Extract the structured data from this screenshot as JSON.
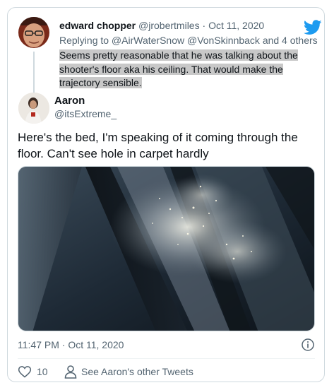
{
  "colors": {
    "brand": "#1d9bf0",
    "muted": "#536471",
    "border": "#cfd9de",
    "highlight": "#c8c8c8"
  },
  "reply_tweet": {
    "display_name": "edward chopper",
    "handle": "@jrobertmiles",
    "separator": "·",
    "date": "Oct 11, 2020",
    "replying_to": "Replying to @AirWaterSnow @VonSkinnback and 4 others",
    "text": "Seems pretty reasonable that he was talking about the shooter's floor aka his ceiling. That would make the trajectory sensible."
  },
  "main_tweet": {
    "display_name": "Aaron",
    "handle": "@itsExtreme_",
    "text": "Here's the bed, I'm speaking of it coming through the floor. Can't see hole in carpet hardly",
    "timestamp": "11:47 PM · Oct 11, 2020",
    "likes": "10",
    "see_more": "See Aaron's other Tweets"
  },
  "icons": [
    "twitter-bird-icon",
    "info-icon",
    "heart-icon",
    "person-icon"
  ]
}
